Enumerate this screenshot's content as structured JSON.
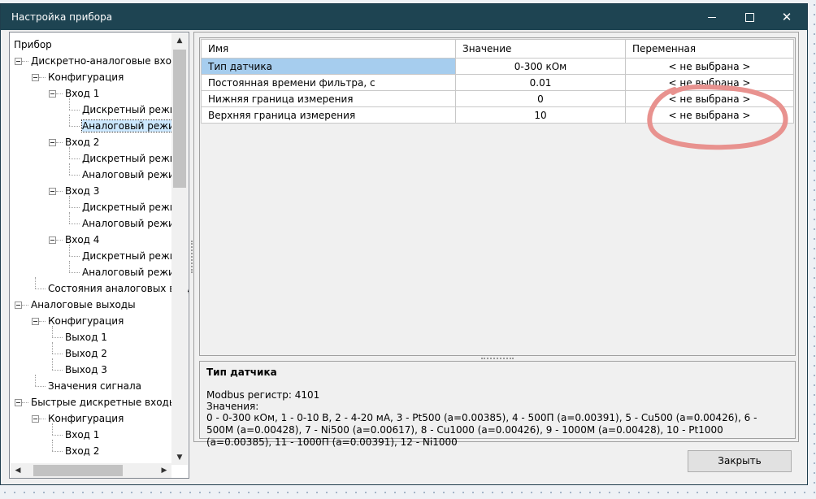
{
  "window": {
    "title": "Настройка прибора"
  },
  "tree": [
    {
      "label": "Прибор",
      "level": 0,
      "expandable": false
    },
    {
      "label": "Дискретно-аналоговые входы",
      "level": 1,
      "expandable": true
    },
    {
      "label": "Конфигурация",
      "level": 2,
      "expandable": true
    },
    {
      "label": "Вход 1",
      "level": 3,
      "expandable": true
    },
    {
      "label": "Дискретный режим",
      "level": 4,
      "expandable": false
    },
    {
      "label": "Аналоговый режим",
      "level": 4,
      "expandable": false,
      "selected": true
    },
    {
      "label": "Вход 2",
      "level": 3,
      "expandable": true
    },
    {
      "label": "Дискретный режим",
      "level": 4,
      "expandable": false
    },
    {
      "label": "Аналоговый режим",
      "level": 4,
      "expandable": false
    },
    {
      "label": "Вход 3",
      "level": 3,
      "expandable": true
    },
    {
      "label": "Дискретный режим",
      "level": 4,
      "expandable": false
    },
    {
      "label": "Аналоговый режим",
      "level": 4,
      "expandable": false
    },
    {
      "label": "Вход 4",
      "level": 3,
      "expandable": true
    },
    {
      "label": "Дискретный режим",
      "level": 4,
      "expandable": false
    },
    {
      "label": "Аналоговый режим",
      "level": 4,
      "expandable": false
    },
    {
      "label": "Состояния аналоговых входов",
      "level": 2,
      "expandable": false
    },
    {
      "label": "Аналоговые выходы",
      "level": 1,
      "expandable": true
    },
    {
      "label": "Конфигурация",
      "level": 2,
      "expandable": true
    },
    {
      "label": "Выход 1",
      "level": 3,
      "expandable": false
    },
    {
      "label": "Выход 2",
      "level": 3,
      "expandable": false
    },
    {
      "label": "Выход 3",
      "level": 3,
      "expandable": false
    },
    {
      "label": "Значения сигнала",
      "level": 2,
      "expandable": false
    },
    {
      "label": "Быстрые дискретные входы",
      "level": 1,
      "expandable": true
    },
    {
      "label": "Конфигурация",
      "level": 2,
      "expandable": true
    },
    {
      "label": "Вход 1",
      "level": 3,
      "expandable": false
    },
    {
      "label": "Вход 2",
      "level": 3,
      "expandable": false
    }
  ],
  "grid": {
    "headers": [
      "Имя",
      "Значение",
      "Переменная"
    ],
    "rows": [
      {
        "name": "Тип датчика",
        "value": "0-300 кОм",
        "variable": "< не выбрана >"
      },
      {
        "name": "Постоянная времени фильтра, с",
        "value": "0.01",
        "variable": "< не выбрана >"
      },
      {
        "name": "Нижняя граница измерения",
        "value": "0",
        "variable": "< не выбрана >"
      },
      {
        "name": "Верхняя граница измерения",
        "value": "10",
        "variable": "< не выбрана >"
      }
    ]
  },
  "description": {
    "title": "Тип датчика",
    "register": "Modbus регистр: 4101",
    "values_label": "Значения:",
    "values_text": "0 - 0-300 кОм, 1 - 0-10 В, 2 - 4-20 мА, 3 - Pt500 (a=0.00385), 4 - 500П (a=0.00391), 5 - Cu500 (a=0.00426), 6 - 500М (a=0.00428), 7 - Ni500 (a=0.00617), 8 - Cu1000 (a=0.00426), 9 - 1000М (a=0.00428), 10 - Pt1000 (a=0.00385), 11 - 1000П (a=0.00391), 12 - Ni1000"
  },
  "buttons": {
    "close": "Закрыть"
  },
  "annotation": {
    "color": "#e8928f"
  }
}
